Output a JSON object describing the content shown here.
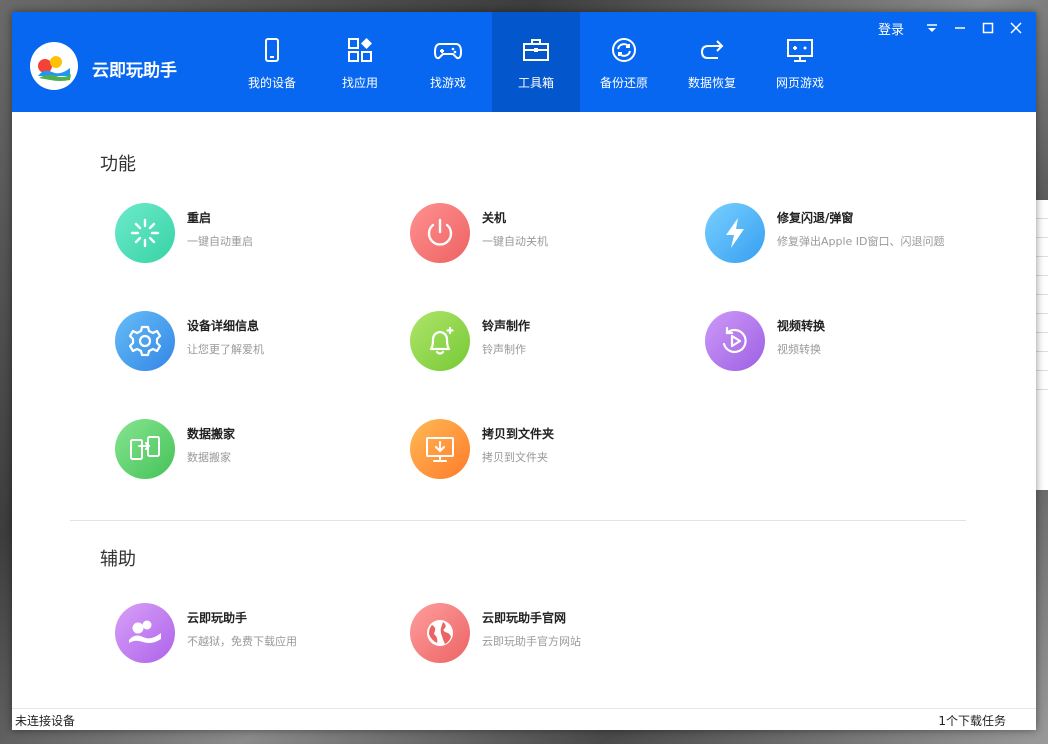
{
  "app": {
    "name": "云即玩助手"
  },
  "window_controls": {
    "login": "登录"
  },
  "nav": [
    {
      "label": "我的设备",
      "icon": "phone-icon"
    },
    {
      "label": "找应用",
      "icon": "apps-icon"
    },
    {
      "label": "找游戏",
      "icon": "gamepad-icon"
    },
    {
      "label": "工具箱",
      "icon": "toolbox-icon",
      "active": true
    },
    {
      "label": "备份还原",
      "icon": "sync-icon"
    },
    {
      "label": "数据恢复",
      "icon": "redo-arrow-icon"
    },
    {
      "label": "网页游戏",
      "icon": "monitor-game-icon"
    }
  ],
  "sections": {
    "functions": {
      "title": "功能",
      "items": [
        {
          "title": "重启",
          "desc": "一键自动重启",
          "icon": "restart-icon",
          "color_from": "#5fe3c0",
          "color_to": "#3fd6a8"
        },
        {
          "title": "关机",
          "desc": "一键自动关机",
          "icon": "power-icon",
          "color_from": "#ff8a8a",
          "color_to": "#f16767"
        },
        {
          "title": "修复闪退/弹窗",
          "desc": "修复弹出Apple ID窗口、闪退问题",
          "icon": "lightning-icon",
          "color_from": "#6bc7ff",
          "color_to": "#3ea6f4"
        },
        {
          "title": "设备详细信息",
          "desc": "让您更了解爱机",
          "icon": "gear-icon",
          "color_from": "#5fb6f5",
          "color_to": "#3a8ee8"
        },
        {
          "title": "铃声制作",
          "desc": "铃声制作",
          "icon": "bell-icon",
          "color_from": "#a8e060",
          "color_to": "#7ccc3a"
        },
        {
          "title": "视频转换",
          "desc": "视频转换",
          "icon": "video-convert-icon",
          "color_from": "#c592f5",
          "color_to": "#a265e6"
        },
        {
          "title": "数据搬家",
          "desc": "数据搬家",
          "icon": "data-transfer-icon",
          "color_from": "#7fe08a",
          "color_to": "#4cc65e"
        },
        {
          "title": "拷贝到文件夹",
          "desc": "拷贝到文件夹",
          "icon": "copy-folder-icon",
          "color_from": "#ffb14a",
          "color_to": "#ff7f2e"
        }
      ]
    },
    "assist": {
      "title": "辅助",
      "items": [
        {
          "title": "云即玩助手",
          "desc": "不越狱，免费下载应用",
          "icon": "app-logo-icon",
          "color_from": "#d59af7",
          "color_to": "#b26ceb"
        },
        {
          "title": "云即玩助手官网",
          "desc": "云即玩助手官方网站",
          "icon": "globe-icon",
          "color_from": "#ff9a9a",
          "color_to": "#f06a6a"
        }
      ]
    }
  },
  "status": {
    "left": "未连接设备",
    "right": "1个下载任务"
  },
  "colors": {
    "titlebar": "#0767f0",
    "active_tab": "#0456cc"
  }
}
